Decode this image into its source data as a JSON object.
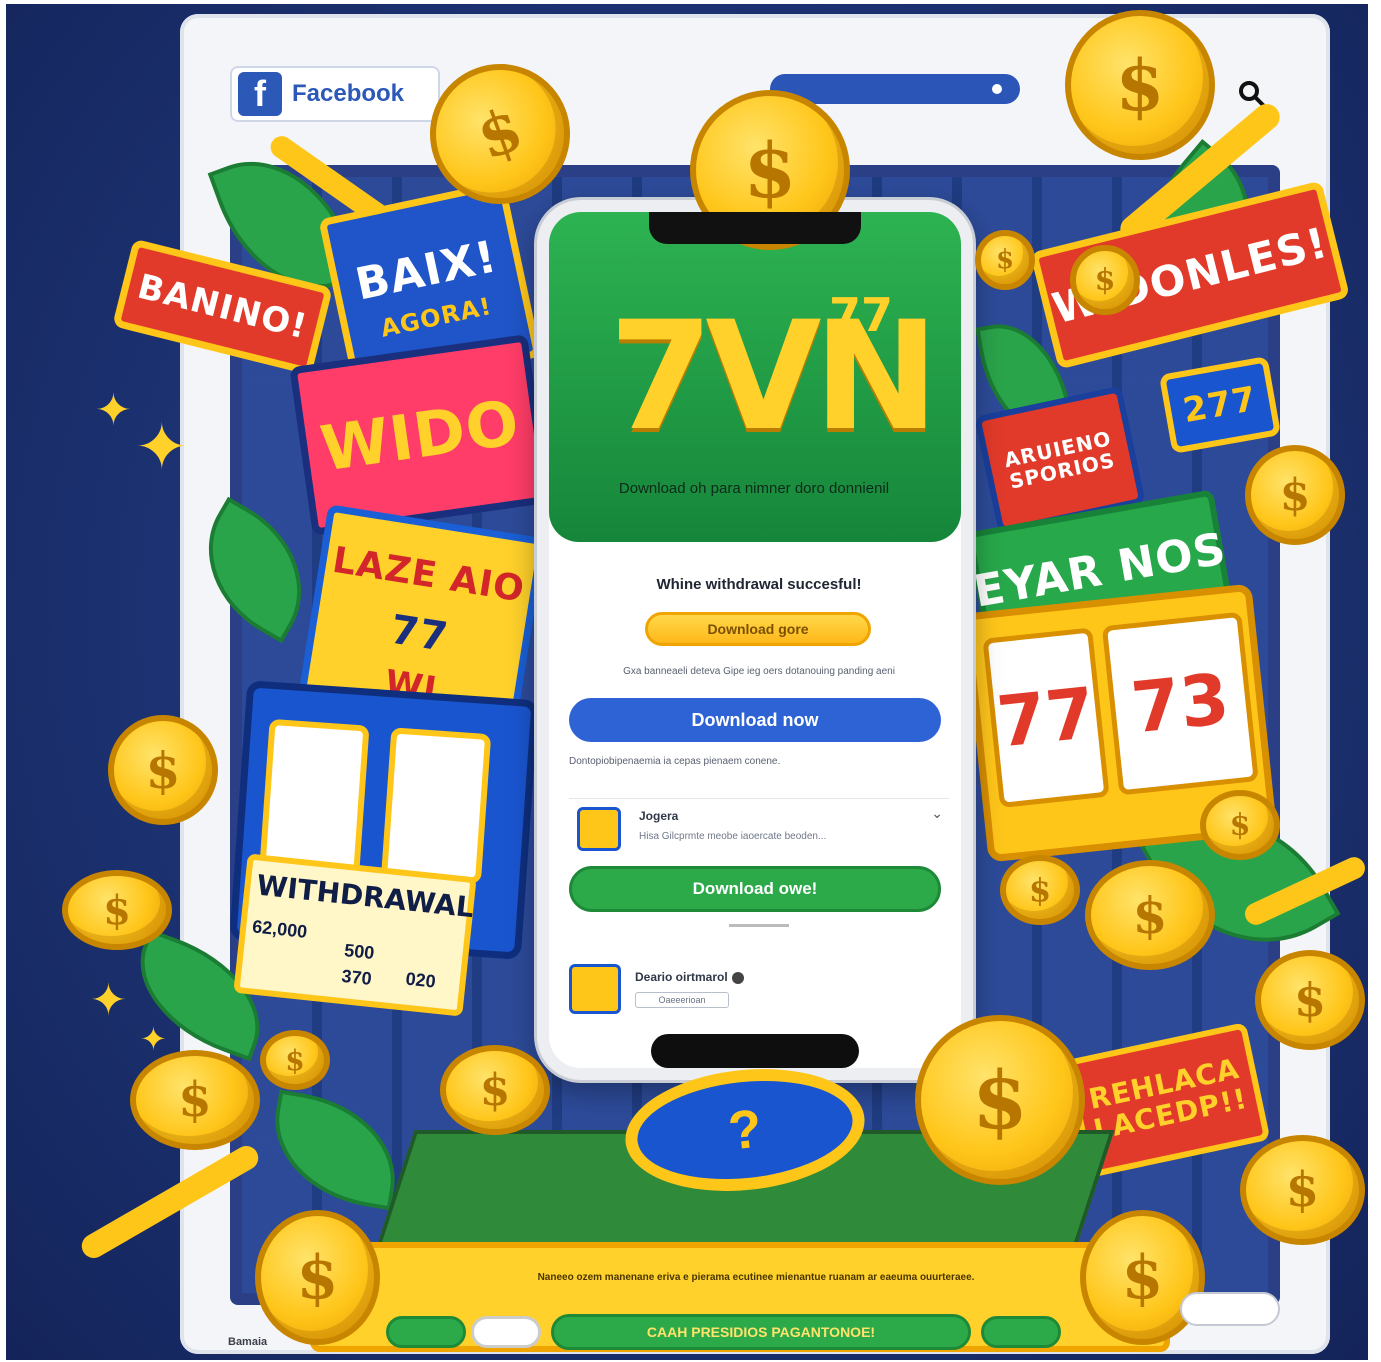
{
  "browser": {
    "brand_label": "Facebook",
    "brand_icon": "f",
    "search_icon": "search-icon"
  },
  "signs": {
    "banino": "BANINO!",
    "baix_main": "BAIX!",
    "baix_sub": "AGORA!",
    "wido": "WIDO",
    "laze_row1": "LAZE AIO",
    "laze_row2": "77",
    "laze_row3": "WI",
    "withdrawal": "WITHDRAWAL",
    "withdrawal_value_1": "62,000",
    "withdrawal_value_2": "500",
    "withdrawal_value_3": "370",
    "withdrawal_value_4": "020",
    "widonles": "WIDONLES!",
    "aruieno_1": "ARUIENO",
    "aruieno_2": "SPORIOS",
    "chip_277": "277",
    "eyar_nos": "EYAR NOS",
    "slot_right_1": "77",
    "slot_right_2": "73",
    "rehlaca_1": "REHLACA",
    "rehlaca_2": "LACEDP!!"
  },
  "phone": {
    "logo_main": "7VN",
    "logo_sup": "77",
    "caption": "Download oh para nimner doro donnienil",
    "headline": "Whine withdrawal succesful!",
    "btn_yellow": "Download gore",
    "fine_print": "Gxa banneaeli deteva Gipe ieg oers dotanouing panding aeni",
    "btn_blue": "Download now",
    "fine_print_2": "Dontopiobipenaemia ia cepas pienaem conene.",
    "card1_title": "Jogera",
    "card1_sub": "Hisa Gilcprmte meobe iaoercate beoden...",
    "btn_green": "Download owe!",
    "card2_title": "Deario oirtmarol",
    "card2_pill": "Oaeeerioan"
  },
  "chip_label": "?",
  "footer": {
    "fine_text": "Naneeo ozem manenane eriva e pierama ecutinee mienantue ruanam ar eaeuma ouurteraee.",
    "cta": "CAAH PRESIDIOS PAGANTONOE!"
  },
  "bottom_left_text": "Bamaia",
  "coin_symbol": "$",
  "colors": {
    "navy": "#1c3272",
    "green": "#2caa4a",
    "yellow": "#ffc61a",
    "red": "#e23a2a",
    "blue": "#2e63d6"
  }
}
